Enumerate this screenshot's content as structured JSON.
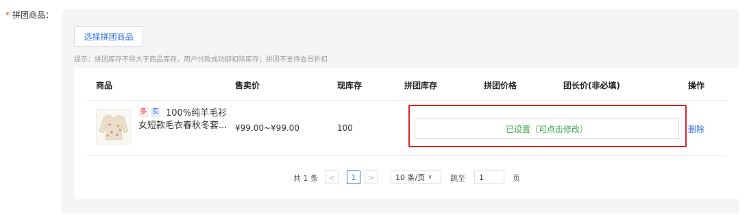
{
  "form": {
    "required_mark": "*",
    "label": "拼团商品："
  },
  "select_button": "选择拼团商品",
  "tip": "提示：拼团库存不得大于商品库存，用户付款成功即扣除库存；拼团不支持会员折扣",
  "table": {
    "headers": [
      "商品",
      "售卖价",
      "现库存",
      "拼团库存",
      "拼团价格",
      "团长价(非必填)",
      "操作"
    ],
    "row": {
      "badge_multi": "多",
      "badge_real": "实",
      "name_line1": "100%纯羊毛衫",
      "name_line2": "女短款毛衣春秋冬套...",
      "price": "¥99.00~¥99.00",
      "stock": "100",
      "status_button": "已设置（可点击修改）",
      "delete": "删除"
    }
  },
  "pagination": {
    "total": "共 1 条",
    "prev": "<",
    "current": "1",
    "next": ">",
    "page_size": "10 条/页",
    "jump_label": "跳至",
    "jump_value": "1",
    "page_unit": "页"
  },
  "colors": {
    "accent": "#2f6de6",
    "danger": "#e02020",
    "success": "#3aa54a"
  }
}
